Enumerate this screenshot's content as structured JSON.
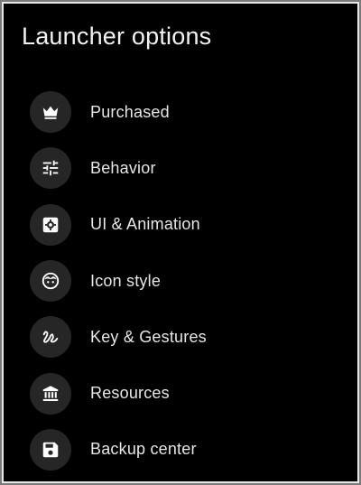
{
  "dialog": {
    "title": "Launcher options"
  },
  "menu": {
    "items": [
      {
        "label": "Purchased",
        "icon": "crown-icon"
      },
      {
        "label": "Behavior",
        "icon": "sliders-icon"
      },
      {
        "label": "UI & Animation",
        "icon": "gear-square-icon"
      },
      {
        "label": "Icon style",
        "icon": "face-icon"
      },
      {
        "label": "Key & Gestures",
        "icon": "gesture-icon"
      },
      {
        "label": "Resources",
        "icon": "bank-icon"
      },
      {
        "label": "Backup center",
        "icon": "floppy-disk-icon"
      }
    ]
  },
  "colors": {
    "background": "#000000",
    "icon_circle": "#262626",
    "text": "#e6e6e6",
    "border": "#e8e8e8"
  }
}
